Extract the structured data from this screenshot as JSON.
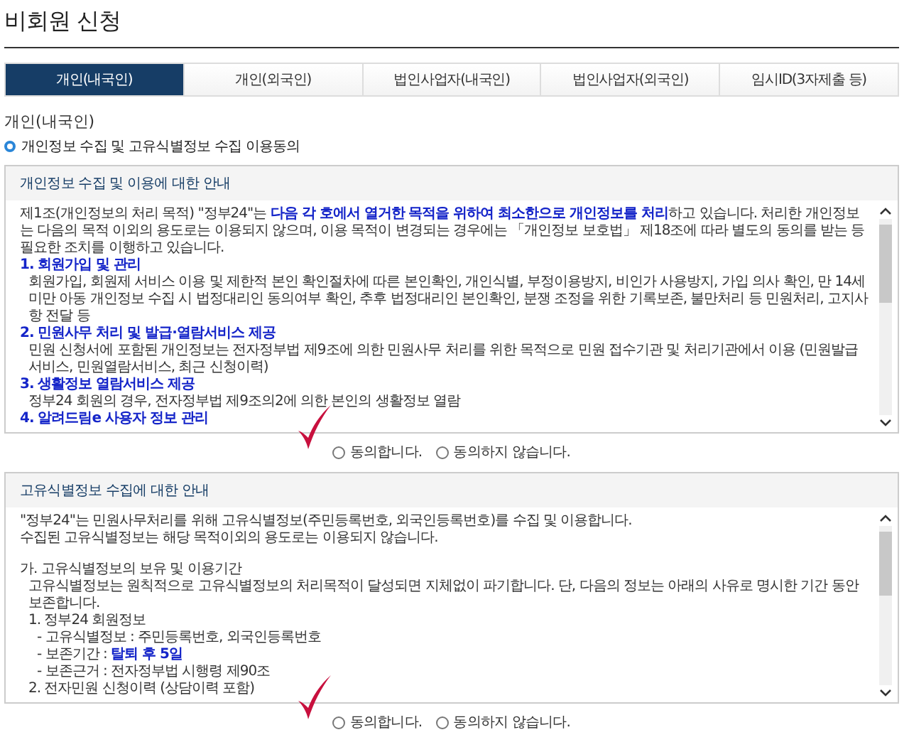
{
  "page_title": "비회원 신청",
  "tabs": [
    {
      "label": "개인(내국인)",
      "selected": true
    },
    {
      "label": "개인(외국인)",
      "selected": false
    },
    {
      "label": "법인사업자(내국인)",
      "selected": false
    },
    {
      "label": "법인사업자(외국인)",
      "selected": false
    },
    {
      "label": "임시ID(3자제출 등)",
      "selected": false
    }
  ],
  "section_title": "개인(내국인)",
  "consent_heading": "개인정보 수집 및 고유식별정보 수집 이용동의",
  "panels": [
    {
      "title": "개인정보 수집 및 이용에 대한 안내",
      "lines": [
        {
          "kind": "para",
          "text": "제1조(개인정보의 처리 목적) \"정부24\"는 **다음 각 호에서 열거한 목적을 위하여 최소한으로 개인정보를 처리**하고 있습니다. 처리한 개인정보는 다음의 목적 이외의 용도로는 이용되지 않으며, 이용 목적이 변경되는 경우에는 「개인정보 보호법」 제18조에 따라 별도의 동의를 받는 등 필요한 조치를 이행하고 있습니다."
        },
        {
          "kind": "heading",
          "text": "1. 회원가입 및 관리"
        },
        {
          "kind": "detail",
          "text": "회원가입, 회원제 서비스 이용 및 제한적 본인 확인절차에 따른 본인확인, 개인식별, 부정이용방지, 비인가 사용방지, 가입 의사 확인, 만 14세 미만 아동 개인정보 수집 시 법정대리인 동의여부 확인, 추후 법정대리인 본인확인, 분쟁 조정을 위한 기록보존, 불만처리 등 민원처리, 고지사항 전달 등"
        },
        {
          "kind": "heading",
          "text": "2. 민원사무 처리 및 발급·열람서비스 제공"
        },
        {
          "kind": "detail",
          "text": "민원 신청서에 포함된 개인정보는 전자정부법 제9조에 의한 민원사무 처리를 위한 목적으로 민원 접수기관 및 처리기관에서 이용 (민원발급서비스, 민원열람서비스, 최근 신청이력)"
        },
        {
          "kind": "heading",
          "text": "3. 생활정보 열람서비스 제공"
        },
        {
          "kind": "detail",
          "text": "정부24 회원의 경우, 전자정부법 제9조의2에 의한 본인의 생활정보 열람"
        },
        {
          "kind": "heading",
          "text": "4. 알려드림e 사용자 정보 관리"
        }
      ],
      "options": [
        {
          "label": "동의합니다.",
          "selected": false
        },
        {
          "label": "동의하지 않습니다.",
          "selected": false
        }
      ]
    },
    {
      "title": "고유식별정보 수집에 대한 안내",
      "lines": [
        {
          "kind": "para",
          "text": "\"정부24\"는 민원사무처리를 위해 고유식별정보(주민등록번호, 외국인등록번호)를 수집 및 이용합니다."
        },
        {
          "kind": "para",
          "text": "수집된 고유식별정보는 해당 목적이외의 용도로는 이용되지 않습니다."
        },
        {
          "kind": "section",
          "text": "가. 고유식별정보의 보유 및 이용기간"
        },
        {
          "kind": "detail",
          "text": "고유식별정보는 원칙적으로 고유식별정보의 처리목적이 달성되면 지체없이 파기합니다. 단, 다음의 정보는 아래의 사유로 명시한 기간 동안 보존합니다."
        },
        {
          "kind": "detail",
          "text": "1. 정부24 회원정보"
        },
        {
          "kind": "subdetail",
          "text": "- 고유식별정보 : 주민등록번호, 외국인등록번호"
        },
        {
          "kind": "subdetail",
          "text": "- 보존기간 : **탈퇴 후 5일**"
        },
        {
          "kind": "subdetail",
          "text": "- 보존근거 : 전자정부법 시행령 제90조"
        },
        {
          "kind": "detail",
          "text": "2. 전자민원 신청이력 (상담이력 포함)"
        }
      ],
      "options": [
        {
          "label": "동의합니다.",
          "selected": false
        },
        {
          "label": "동의하지 않습니다.",
          "selected": false
        }
      ]
    }
  ]
}
